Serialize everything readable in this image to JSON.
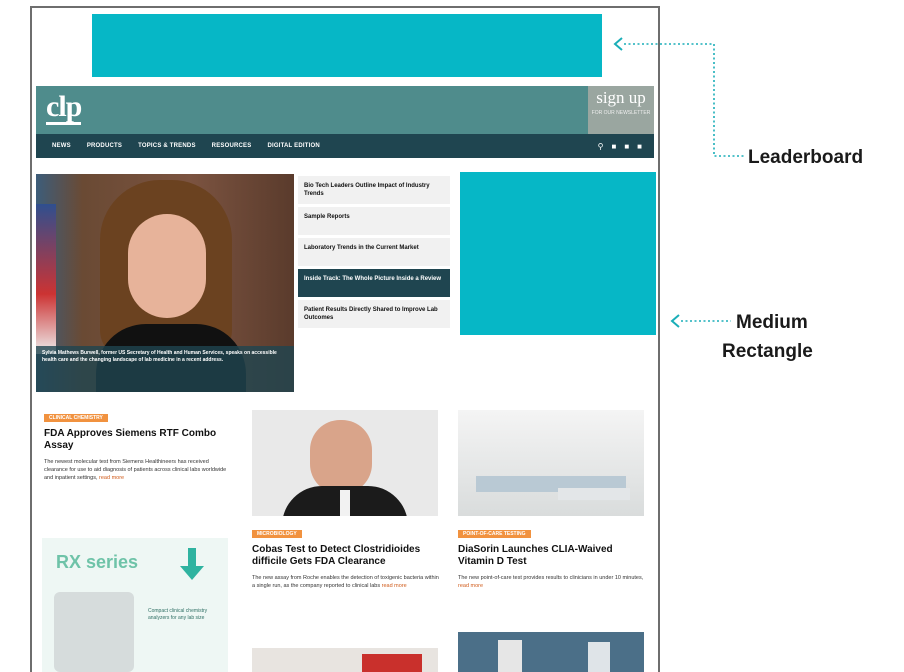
{
  "callouts": {
    "leaderboard": "Leaderboard",
    "medium_rectangle_line1": "Medium",
    "medium_rectangle_line2": "Rectangle"
  },
  "site": {
    "logo": "clp",
    "signup": {
      "title": "sign up",
      "subtitle": "FOR OUR NEWSLETTER"
    }
  },
  "nav": {
    "items": [
      "News",
      "Products",
      "Topics & Trends",
      "Resources",
      "Digital Edition"
    ],
    "icons": [
      "search-icon",
      "facebook-icon",
      "twitter-icon",
      "linkedin-icon"
    ]
  },
  "hero": {
    "caption": "Sylvia Mathews Burwell, former US Secretary of Health and Human Services, speaks on accessible health care and the changing landscape of lab medicine in a recent address."
  },
  "stories": [
    {
      "title": "Bio Tech Leaders Outline Impact of Industry Trends",
      "active": false
    },
    {
      "title": "Sample Reports",
      "active": false
    },
    {
      "title": "Laboratory Trends in the Current Market",
      "active": false
    },
    {
      "title": "Inside Track: The Whole Picture Inside a Review",
      "active": true
    },
    {
      "title": "Patient Results Directly Shared to Improve Lab Outcomes",
      "active": false
    }
  ],
  "articles": [
    {
      "tag": "Clinical Chemistry",
      "title": "FDA Approves Siemens RTF Combo Assay",
      "body": "The newest molecular test from Siemens Healthineers has received clearance for use to aid diagnosis of patients across clinical labs worldwide and inpatient settings,",
      "link": "read more"
    },
    {
      "tag": "Microbiology",
      "title": "Cobas Test to Detect Clostridioides difficile Gets FDA Clearance",
      "body": "The new assay from Roche enables the detection of toxigenic bacteria within a single run, as the company reported to clinical labs",
      "link": "read more"
    },
    {
      "tag": "Point-of-Care Testing",
      "title": "DiaSorin Launches CLIA-Waived Vitamin D Test",
      "body": "The new point-of-care test provides results to clinicians in under 10 minutes,",
      "link": "read more"
    }
  ],
  "ad": {
    "brand": "RX series",
    "text": "Compact clinical chemistry analyzers for any lab size"
  },
  "colors": {
    "ad_placeholder": "#06b7c6",
    "header": "#4f8c8c",
    "nav": "#1f4550",
    "tag": "#f1923f"
  }
}
